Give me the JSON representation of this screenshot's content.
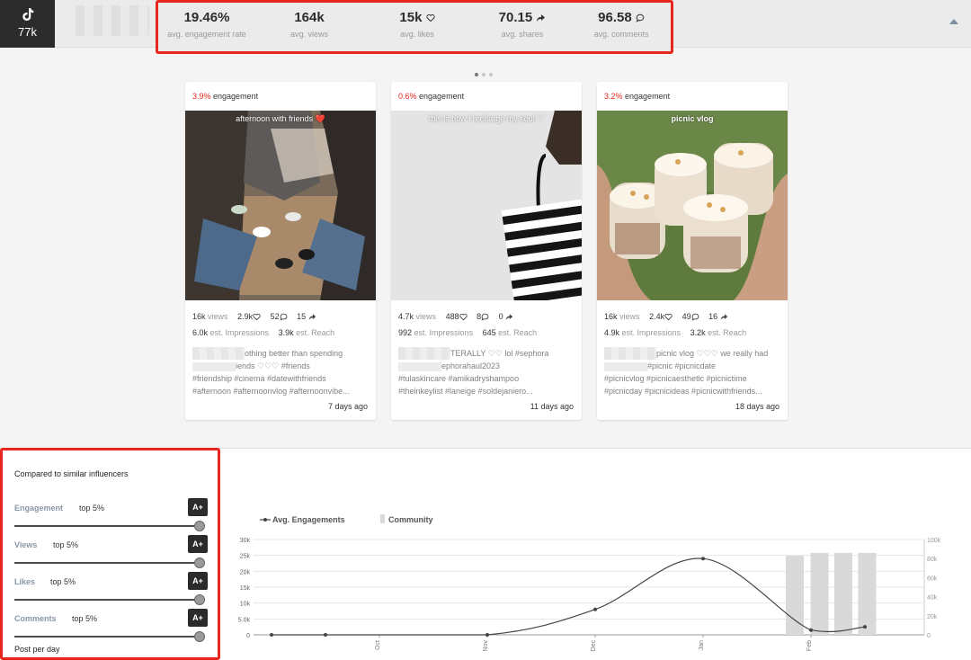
{
  "platform": {
    "icon": "tiktok-icon",
    "followers": "77k"
  },
  "stats": [
    {
      "value": "19.46%",
      "label": "avg. engagement rate",
      "icon": ""
    },
    {
      "value": "164k",
      "label": "avg. views",
      "icon": ""
    },
    {
      "value": "15k",
      "label": "avg. likes",
      "icon": "heart-icon"
    },
    {
      "value": "70.15",
      "label": "avg. shares",
      "icon": "share-icon"
    },
    {
      "value": "96.58",
      "label": "avg. comments",
      "icon": "comment-icon"
    }
  ],
  "carousel": {
    "pages": 3,
    "active": 0
  },
  "posts": [
    {
      "engagement_pct": "3.9%",
      "engagement_label": "engagement",
      "caption": "afternoon with friends ❤️",
      "views": "16k",
      "likes": "2.9k",
      "comments": "52",
      "shares": "15",
      "impressions": "6.0k",
      "reach": "3.9k",
      "desc_line1": "othing better than spending",
      "desc_line2": "iends ♡♡♡ #friends",
      "desc_line3": "#friendship #cinema #datewithfriends",
      "desc_line4": "#afternoon #afternoonvlog #afternoonvibe...",
      "ago": "7 days ago"
    },
    {
      "engagement_pct": "0.6%",
      "engagement_label": "engagement",
      "caption": "this is how i recharge my soul ♡",
      "views": "4.7k",
      "likes": "488",
      "comments": "8",
      "shares": "0",
      "impressions": "992",
      "reach": "645",
      "desc_line1": "TERALLY ♡♡ lol #sephora",
      "desc_line2": "ephorahaul2023",
      "desc_line3": "#tulaskincare #amikadryshampoo",
      "desc_line4": "#theinkeylist #laneige #soldejaniero...",
      "ago": "11 days ago"
    },
    {
      "engagement_pct": "3.2%",
      "engagement_label": "engagement",
      "caption": "picnic vlog",
      "views": "16k",
      "likes": "2.4k",
      "comments": "49",
      "shares": "16",
      "impressions": "4.9k",
      "reach": "3.2k",
      "desc_line1": "picnic vlog ♡♡♡ we really had",
      "desc_line2": "#picnic #picnicdate",
      "desc_line3": "#picnicvlog #picnicaesthetic #picnictime",
      "desc_line4": "#picnicday #picnicideas #picnicwithfriends...",
      "ago": "18 days ago"
    }
  ],
  "labels": {
    "views": "views",
    "impressions": "est. Impressions",
    "reach": "est. Reach"
  },
  "compare": {
    "title": "Compared to similar influencers",
    "metrics": [
      {
        "name": "Engagement",
        "rank": "top 5%",
        "grade": "A+",
        "level": 0.98
      },
      {
        "name": "Views",
        "rank": "top 5%",
        "grade": "A+",
        "level": 0.98
      },
      {
        "name": "Likes",
        "rank": "top 5%",
        "grade": "A+",
        "level": 0.98
      },
      {
        "name": "Comments",
        "rank": "top 5%",
        "grade": "A+",
        "level": 0.98
      }
    ],
    "next_label": "Post per day"
  },
  "chart_data": {
    "type": "line",
    "legend": [
      {
        "name": "Avg. Engagements",
        "kind": "line"
      },
      {
        "name": "Community",
        "kind": "bar"
      }
    ],
    "x_ticks": [
      "Oct",
      "Nov",
      "Dec",
      "Jan",
      "Feb"
    ],
    "y_left_ticks": [
      "0",
      "5.0k",
      "10k",
      "15k",
      "20k",
      "25k",
      "30k"
    ],
    "y_right_ticks": [
      "0",
      "20k",
      "40k",
      "60k",
      "80k",
      "100k"
    ],
    "ylim_left": [
      0,
      30000
    ],
    "ylim_right": [
      0,
      100000
    ],
    "series": [
      {
        "name": "Avg. Engagements",
        "points": [
          [
            0.0,
            0
          ],
          [
            0.5,
            0
          ],
          [
            2.0,
            0
          ],
          [
            3.0,
            8000
          ],
          [
            4.0,
            24000
          ],
          [
            5.0,
            1500
          ],
          [
            5.5,
            2500
          ]
        ]
      },
      {
        "name": "Community",
        "bars": [
          [
            4.85,
            83000
          ],
          [
            5.08,
            86000
          ],
          [
            5.3,
            86000
          ],
          [
            5.52,
            86000
          ]
        ]
      }
    ],
    "colors": {
      "line": "#444444",
      "bar": "#d9d9d9",
      "grid": "#e6e6e6",
      "axis": "#999999"
    }
  }
}
